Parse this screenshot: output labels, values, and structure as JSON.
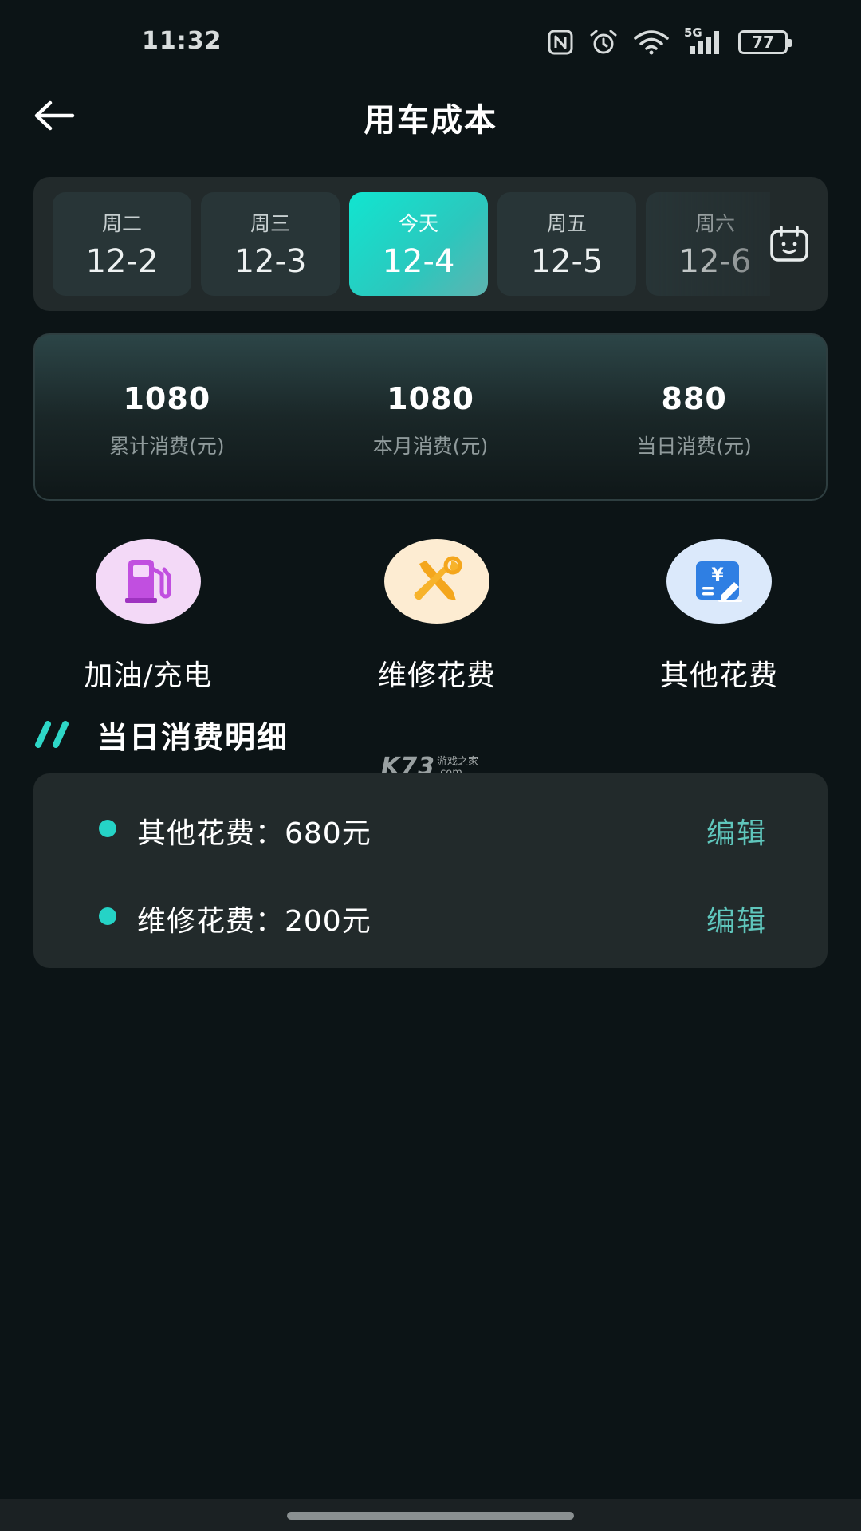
{
  "status_bar": {
    "time": "11:32",
    "battery": "77",
    "network": "5G",
    "icons": [
      "nfc-icon",
      "alarm-icon",
      "wifi-icon",
      "cellular-signal-icon",
      "battery-icon"
    ]
  },
  "header": {
    "title": "用车成本",
    "back_icon": "arrow-left-icon"
  },
  "date_strip": {
    "selected_index": 2,
    "items": [
      {
        "weekday": "周二",
        "day": "12-2"
      },
      {
        "weekday": "周三",
        "day": "12-3"
      },
      {
        "weekday": "今天",
        "day": "12-4"
      },
      {
        "weekday": "周五",
        "day": "12-5"
      },
      {
        "weekday": "周六",
        "day": "12-6"
      }
    ],
    "calendar_icon": "calendar-icon"
  },
  "summary": {
    "total": {
      "value": "1080",
      "label": "累计消费(元)"
    },
    "month": {
      "value": "1080",
      "label": "本月消费(元)"
    },
    "day": {
      "value": "880",
      "label": "当日消费(元)"
    }
  },
  "categories": [
    {
      "label": "加油/充电",
      "icon": "fuel-pump-icon",
      "bg": "#f3d9f7",
      "color": "#c14fe0"
    },
    {
      "label": "维修花费",
      "icon": "wrench-screwdriver-icon",
      "bg": "#fdecd2",
      "color": "#f7a51b"
    },
    {
      "label": "其他花费",
      "icon": "yuan-bill-icon",
      "bg": "#dbe9fb",
      "color": "#2f7fe3"
    }
  ],
  "detail": {
    "section_title": "当日消费明细",
    "rows": [
      {
        "text": "其他花费：680元",
        "edit": "编辑"
      },
      {
        "text": "维修花费：200元",
        "edit": "编辑"
      }
    ]
  },
  "watermark": {
    "logo": "K73",
    "line1": "游戏之家",
    "line2": ".com"
  },
  "colors": {
    "accent": "#25d3c6",
    "background": "#0c1416",
    "card": "#222a2b"
  }
}
